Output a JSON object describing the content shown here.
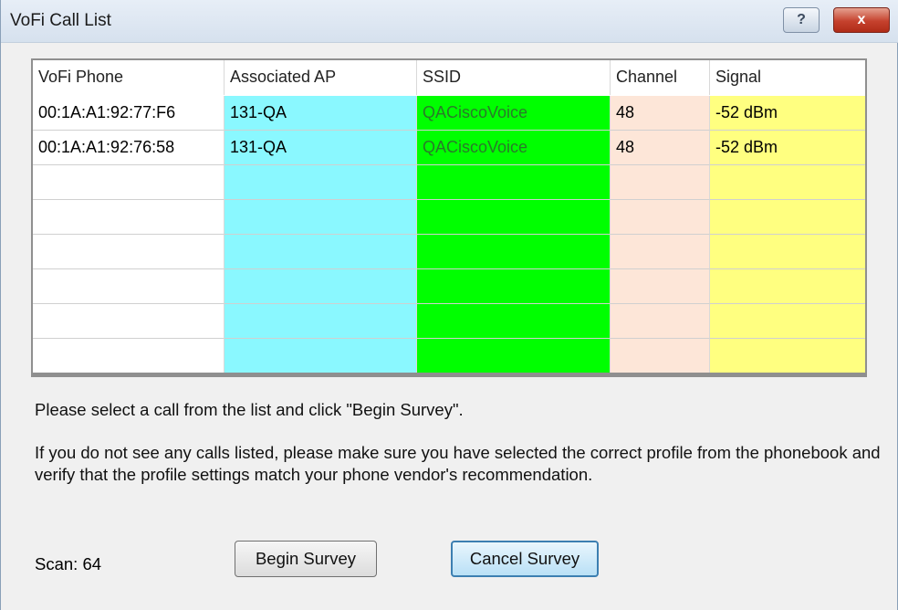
{
  "window": {
    "title": "VoFi Call List",
    "help_glyph": "?",
    "close_glyph": "x"
  },
  "list": {
    "columns": [
      "VoFi Phone",
      "Associated AP",
      "SSID",
      "Channel",
      "Signal"
    ],
    "rows": [
      [
        "00:1A:A1:92:77:F6",
        "131-QA",
        "QACiscoVoice",
        "48",
        "-52 dBm"
      ],
      [
        "00:1A:A1:92:76:58",
        "131-QA",
        "QACiscoVoice",
        "48",
        "-52 dBm"
      ],
      [
        "",
        "",
        "",
        "",
        ""
      ],
      [
        "",
        "",
        "",
        "",
        ""
      ],
      [
        "",
        "",
        "",
        "",
        ""
      ],
      [
        "",
        "",
        "",
        "",
        ""
      ],
      [
        "",
        "",
        "",
        "",
        ""
      ],
      [
        "",
        "",
        "",
        "",
        ""
      ]
    ],
    "column_colors": [
      "#ffffff",
      "#8af8ff",
      "#00ff00",
      "#fde6d8",
      "#ffff80"
    ]
  },
  "messages": {
    "select": "Please select a call from the list and click \"Begin Survey\".",
    "help": " If you do not see any calls listed, please make sure you have selected the correct profile from the phonebook and verify that the profile settings match your phone vendor's recommendation."
  },
  "status": {
    "scan": "Scan: 64"
  },
  "buttons": {
    "begin": "Begin Survey",
    "cancel": "Cancel Survey"
  }
}
